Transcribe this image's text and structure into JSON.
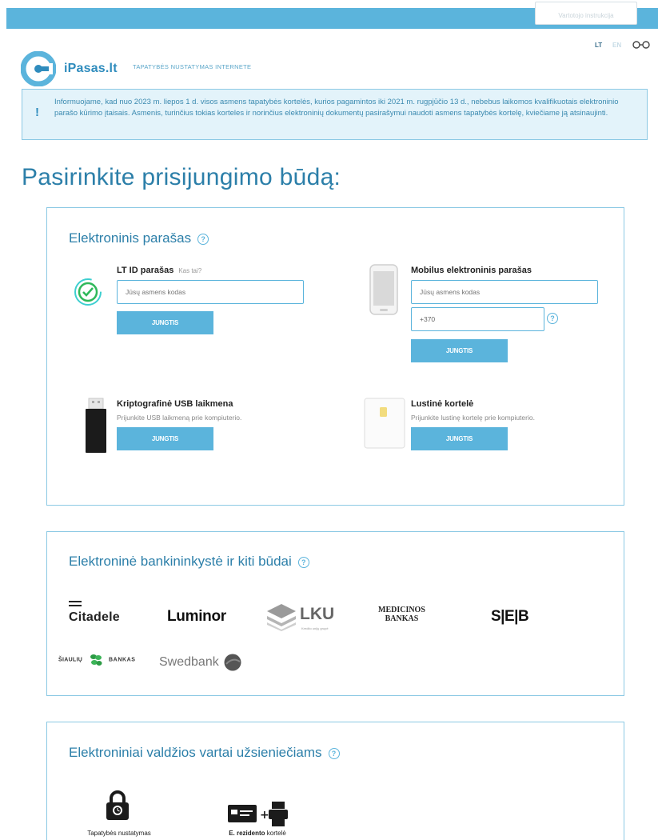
{
  "header": {
    "top_button_label": "Vartotojo instrukcija",
    "lang_lt": "LT",
    "lang_en": "EN",
    "brand": "iPasas.lt",
    "tagline": "TAPATYBĖS NUSTATYMAS INTERNETE",
    "notice_mark": "!",
    "notice": "Informuojame, kad nuo 2023 m. liepos 1 d. visos asmens tapatybės kortelės, kurios pagamintos iki 2021 m. rugpjūčio 13 d., nebebus laikomos kvalifikuotais elektroninio parašo kūrimo įtaisais. Asmenis, turinčius tokias korteles ir norinčius elektroninių dokumentų pasirašymui naudoti asmens tapatybės kortelę, kviečiame ją atsinaujinti."
  },
  "page_title": "Pasirinkite prisijungimo būdą:",
  "signature": {
    "title": "Elektroninis parašas",
    "help": "?",
    "ltid": {
      "title": "LT ID parašas",
      "link": "Kas tai?",
      "placeholder": "Jūsų asmens kodas",
      "button": "JUNGTIS"
    },
    "mobile": {
      "title": "Mobilus elektroninis parašas",
      "placeholder": "Jūsų asmens kodas",
      "phone_value": "+370",
      "help": "?",
      "button": "JUNGTIS"
    },
    "usb": {
      "title": "Kriptografinė USB laikmena",
      "subtitle": "Prijunkite USB laikmeną prie kompiuterio.",
      "button": "JUNGTIS"
    },
    "card": {
      "title": "Lustinė kortelė",
      "subtitle": "Prijunkite lustinę kortelę prie kompiuterio.",
      "button": "JUNGTIS"
    }
  },
  "banking": {
    "title": "Elektroninė bankininkystė ir kiti būdai",
    "help": "?",
    "banks": {
      "citadele": "Citadele",
      "luminor": "Luminor",
      "lku": "LKU",
      "lku_sub": "Kredito unijų grupė",
      "medicinos_1": "MEDICINOS",
      "medicinos_2": "BANKAS",
      "seb": "S|E|B",
      "siauliu_1": "ŠIAULIŲ",
      "siauliu_2": "BANKAS",
      "swedbank": "Swedbank"
    }
  },
  "egov": {
    "title": "Elektroniniai valdžios vartai užsieniečiams",
    "help": "?",
    "item1_label": "Tapatybės nustatymas",
    "item2_bold": "E. rezidento",
    "item2_rest": " kortelė"
  },
  "colors": {
    "accent": "#5bb4dc",
    "title_blue": "#2c7fa9",
    "notice_bg": "#e3f3fa"
  }
}
